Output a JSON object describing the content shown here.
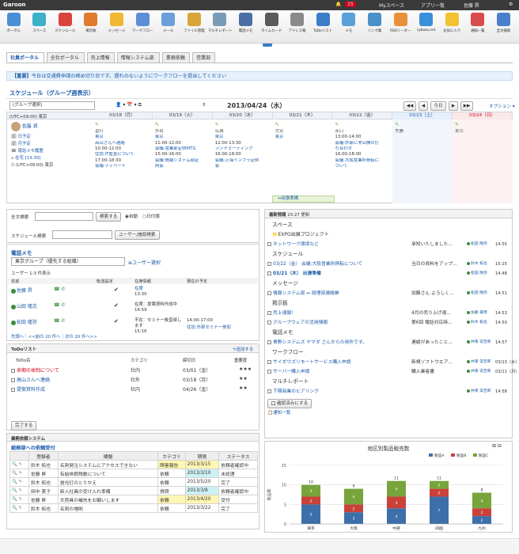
{
  "header": {
    "logo": "Garoon",
    "badge": "15",
    "myspace": "Myスペース",
    "apps": "アプリ一覧",
    "user": "佐藤 昇"
  },
  "apps": [
    {
      "label": "ポータル",
      "color": "#4a8fd6"
    },
    {
      "label": "スペース",
      "color": "#3bb0c9"
    },
    {
      "label": "スケジュール",
      "color": "#d9443c"
    },
    {
      "label": "掲示板",
      "color": "#e07a2e"
    },
    {
      "label": "メッセージ",
      "color": "#f0b733"
    },
    {
      "label": "ワークフロー",
      "color": "#5c8ed6"
    },
    {
      "label": "メール",
      "color": "#6a9fd9"
    },
    {
      "label": "ファイル管理",
      "color": "#d9a53a"
    },
    {
      "label": "マルチレポート",
      "color": "#7a9bb8"
    },
    {
      "label": "電話メモ",
      "color": "#4a6fa5"
    },
    {
      "label": "タイムカード",
      "color": "#5a5a5a"
    },
    {
      "label": "アドレス帳",
      "color": "#8a8a8a"
    },
    {
      "label": "ToDoリスト",
      "color": "#3a7dc9"
    },
    {
      "label": "メモ",
      "color": "#5aa0d9"
    },
    {
      "label": "リンク集",
      "color": "#4a90c9"
    },
    {
      "label": "RSSリーダー",
      "color": "#e8913a"
    },
    {
      "label": "cybozu.net",
      "color": "#3a8fd9"
    },
    {
      "label": "お気に入り",
      "color": "#f2c230"
    },
    {
      "label": "通知一覧",
      "color": "#d94a4a"
    },
    {
      "label": "全文検索",
      "color": "#4a7fc9"
    }
  ],
  "tabs": [
    "社員ポータル",
    "全社ポータル",
    "売上情報",
    "情報システム部",
    "業務依頼",
    "営業部"
  ],
  "notice": {
    "tag": "【重要】",
    "text": "今日は交通費申請の締め切り日です。遅れのないようにワークフローを提出してください"
  },
  "schedule": {
    "title": "スケジュール（グループ週表示）",
    "group": "(グループ選択)",
    "date": "2013/04/24（水）",
    "nav": [
      "◀◀",
      "◀",
      "今日",
      "▶",
      "▶▶"
    ],
    "option": "オプション ▾",
    "tz": "(UTC+09:00) 東京",
    "days": [
      "03/18（月）",
      "03/19（火）",
      "03/20（水）",
      "03/21（木）",
      "03/22（金）",
      "03/23（土）",
      "03/24（日）"
    ],
    "user": {
      "name": "佐藤 昇",
      "links": [
        "日予定",
        "月予定",
        "電話メモ履歴",
        "在宅 [13:30]",
        "(UTC+09:00) 東京"
      ]
    },
    "cells": [
      [
        "直行",
        "東京",
        "高山さんへ連絡",
        "10:00-12:00",
        "往訪:IT監査について",
        "17:00-18:30",
        "会議:ディベート"
      ],
      [
        "外出",
        "東京",
        "11:00-12:00",
        "会議:営業部定例MTG",
        "15:00-16:00",
        "会議:情報システム部定",
        "例会"
      ],
      [
        "仏滅",
        "東京",
        "12:00-13:30",
        "ランチミーティング",
        "16:00-18:00",
        "会議:上海インフラ定例",
        "会"
      ],
      [
        "大安",
        "東京"
      ],
      [
        "赤口",
        "13:00-14:00",
        "会議:外部に非公開の打",
        "ち合わせ",
        "16:00-18:00",
        "会議:大阪営業所移転に",
        "ついて"
      ],
      [
        "先勝"
      ],
      [
        "友引"
      ]
    ],
    "banner": "↔出張準備"
  },
  "search": {
    "label": "全文検索",
    "btn": "検索する",
    "r1": "自動",
    "r2": "日付順"
  },
  "sched_search": {
    "label": "スケジュール検索",
    "btn": "ユーザー/施設検索"
  },
  "phone": {
    "title": "電話メモ",
    "group": "東京グループ（優先する組織）",
    "select_user": "ユーザー選択",
    "count": "ユーザー 1-3 件表示",
    "cols": [
      "名前",
      "転送設定",
      "在席情報",
      "現在の予定"
    ],
    "rows": [
      {
        "name": "佐藤 昇",
        "status": "在席",
        "time": "13:30",
        "sched": ""
      },
      {
        "name": "山田 隆志",
        "status": "在席：提案資料作成中",
        "time": "14:59",
        "sched": ""
      },
      {
        "name": "松田 隆弥",
        "status": "不在：セミナー後直帰します",
        "time": "15:16",
        "sched": "14:00-17:00",
        "sched2": "往訪:外部セミナー参加"
      }
    ],
    "pager": "先頭へ｜<<前の 20 件へ｜次の 20 件へ>>"
  },
  "todo": {
    "title": "ToDoリスト",
    "add": "追加する",
    "cols": [
      "ToDo名",
      "カテゴリ",
      "締切日",
      "重要度"
    ],
    "rows": [
      {
        "name": "来期の体制について",
        "cat": "社内",
        "due": "03/01（金）",
        "pri": "★★★",
        "red": true
      },
      {
        "name": "高山さんへ連絡",
        "cat": "社外",
        "due": "03/18（月）",
        "pri": "★★",
        "red": false
      },
      {
        "name": "提案資料作成",
        "cat": "社内",
        "due": "04/26（金）",
        "pri": "★★",
        "red": false
      }
    ],
    "done": "完了する"
  },
  "gyomu": {
    "title": "業務依頼システム",
    "sub": "総務部への依頼受付",
    "cols": [
      "登録者",
      "標題",
      "カテゴリ",
      "期限",
      "ステータス"
    ],
    "rows": [
      {
        "user": "鈴木 拓也",
        "title": "名刺発注システムにアクセスできない",
        "cat": "障害報告",
        "due": "2013/3/15",
        "status": "依頼者確認中",
        "hl": "yellow"
      },
      {
        "user": "佐藤 昇",
        "title": "有給休暇残数について",
        "cat": "依頼",
        "due": "2013/3/10",
        "status": "未処理",
        "hl": "cyan"
      },
      {
        "user": "鈴木 拓也",
        "title": "蛍光灯のとりかえ",
        "cat": "依頼",
        "due": "2013/5/20",
        "status": "完了",
        "hl": ""
      },
      {
        "user": "田中 美子",
        "title": "新入社員の受け入れ準備",
        "cat": "質問",
        "due": "2013/3/8",
        "status": "依頼者確認中",
        "hl": "cyan"
      },
      {
        "user": "佐藤 昇",
        "title": "文房具の補充をお願いします",
        "cat": "依頼",
        "due": "2013/4/20",
        "status": "受付",
        "hl": "yellow"
      },
      {
        "user": "鈴木 拓也",
        "title": "名刺の増刷",
        "cat": "依頼",
        "due": "2013/3/22",
        "status": "完了",
        "hl": ""
      }
    ]
  },
  "updates": {
    "title": "最新情報",
    "time": "15:27 更新",
    "groups": [
      {
        "h": "スペース",
        "items": [
          {
            "t": "EXPO出展プロジェクト",
            "head": true
          },
          {
            "t": "ネットワーク環境など",
            "d": "承知いたしました...",
            "u": "松田 隆弥",
            "tm": "14:55"
          }
        ]
      },
      {
        "h": "スケジュール",
        "items": [
          {
            "t": "03/22（金） 会議:大阪営業所移転について",
            "d": "当日の資料をアップ...",
            "u": "鈴木 拓也",
            "tm": "15:25"
          },
          {
            "t": "03/21（木） 出張準備",
            "bold": true,
            "d": "",
            "u": "松田 隆弥",
            "tm": "14:48"
          }
        ]
      },
      {
        "h": "メッセージ",
        "items": [
          {
            "t": "情報システム部 ↔ 経理部連絡帳",
            "d": "加藤さん よろしく...",
            "u": "松田 隆弥",
            "tm": "14:51"
          }
        ]
      },
      {
        "h": "掲示板",
        "items": [
          {
            "t": "売上速報！",
            "d": "4月の売り上げ速...",
            "u": "加藤 美博",
            "tm": "14:53"
          },
          {
            "t": "グループウェアの活用情報",
            "d": "第6回 電話対応時...",
            "u": "鈴木 拓也",
            "tm": "14:50"
          }
        ]
      },
      {
        "h": "電話メモ",
        "items": [
          {
            "t": "青野システムズ ヤマダ さんからの用件です。",
            "d": "連絡があったこと...",
            "u": "井東 常吉郎",
            "tm": "14:57"
          }
        ]
      },
      {
        "h": "ワークフロー",
        "items": [
          {
            "t": "サイボウズリモートサービス購入申請",
            "d": "新規ソフトウエア...",
            "u": "井東 常吉郎",
            "tm": "03/13（水）"
          },
          {
            "t": "サーバー購入申請",
            "d": "購入業者書",
            "u": "井東 常吉郎",
            "tm": "03/11（月）"
          }
        ]
      },
      {
        "h": "マルチレポート",
        "items": [
          {
            "t": "下期商業のヒアリング",
            "d": "",
            "u": "井東 常吉郎",
            "tm": "14:58"
          }
        ]
      }
    ],
    "confirm": "確認済みにする",
    "notif": "通知一覧"
  },
  "chart_data": {
    "type": "bar",
    "stacked": true,
    "title": "地区別製品販売数",
    "categories": [
      "東京",
      "大阪",
      "中部",
      "四国",
      "九州"
    ],
    "series": [
      {
        "name": "製品A",
        "color": "#3d6faa",
        "values": [
          5,
          3,
          4,
          7,
          2
        ]
      },
      {
        "name": "製品B",
        "color": "#c9423a",
        "values": [
          2,
          2,
          3,
          2,
          2
        ]
      },
      {
        "name": "製品C",
        "color": "#77a43b",
        "values": [
          3,
          4,
          4,
          2,
          4
        ]
      }
    ],
    "totals": [
      10,
      9,
      11,
      11,
      8
    ],
    "ylabel": "製品数",
    "ylim": [
      0,
      15
    ],
    "yticks": [
      0,
      5,
      10,
      15
    ],
    "grid": true,
    "legend": "top-right"
  }
}
